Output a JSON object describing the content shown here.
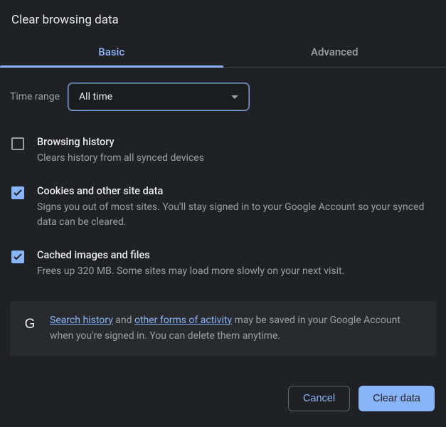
{
  "dialog": {
    "title": "Clear browsing data"
  },
  "tabs": {
    "basic": "Basic",
    "advanced": "Advanced"
  },
  "timeRange": {
    "label": "Time range",
    "value": "All time"
  },
  "options": {
    "browsingHistory": {
      "checked": false,
      "title": "Browsing history",
      "desc": "Clears history from all synced devices"
    },
    "cookies": {
      "checked": true,
      "title": "Cookies and other site data",
      "desc": "Signs you out of most sites. You'll stay signed in to your Google Account so your synced data can be cleared."
    },
    "cache": {
      "checked": true,
      "title": "Cached images and files",
      "desc": "Frees up 320 MB. Some sites may load more slowly on your next visit."
    }
  },
  "notice": {
    "link1": "Search history",
    "mid1": " and ",
    "link2": "other forms of activity",
    "mid2": " may be saved in your Google Account when you're signed in. You can delete them anytime.",
    "gIcon": "G"
  },
  "buttons": {
    "cancel": "Cancel",
    "clear": "Clear data"
  }
}
